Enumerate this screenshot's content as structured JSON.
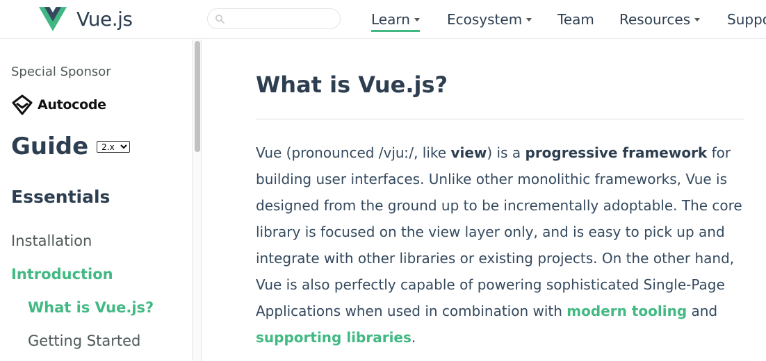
{
  "header": {
    "logo_text": "Vue.js",
    "search_placeholder": "",
    "nav": {
      "learn": "Learn",
      "ecosystem": "Ecosystem",
      "team": "Team",
      "resources": "Resources",
      "support": "Support"
    }
  },
  "sidebar": {
    "sponsor_label": "Special Sponsor",
    "sponsor_name": "Autocode",
    "guide_title": "Guide",
    "version": "2.x",
    "section": "Essentials",
    "links": {
      "installation": "Installation",
      "introduction": "Introduction",
      "what_is": "What is Vue.js?",
      "getting_started": "Getting Started"
    }
  },
  "content": {
    "title": "What is Vue.js?",
    "para": {
      "t1": "Vue (pronounced /vjuː/, like ",
      "b1": "view",
      "t2": ") is a ",
      "b2": "progressive framework",
      "t3": " for building user interfaces. Unlike other monolithic frameworks, Vue is designed from the ground up to be incrementally adoptable. The core library is focused on the view layer only, and is easy to pick up and integrate with other libraries or existing projects. On the other hand, Vue is also perfectly capable of powering sophisticated Single-Page Applications when used in combination with ",
      "link1": "modern tooling",
      "t4": " and ",
      "link2": "supporting libraries",
      "t5": "."
    }
  },
  "colors": {
    "accent": "#42b983",
    "heading": "#2c3e50",
    "text": "#34495e"
  }
}
